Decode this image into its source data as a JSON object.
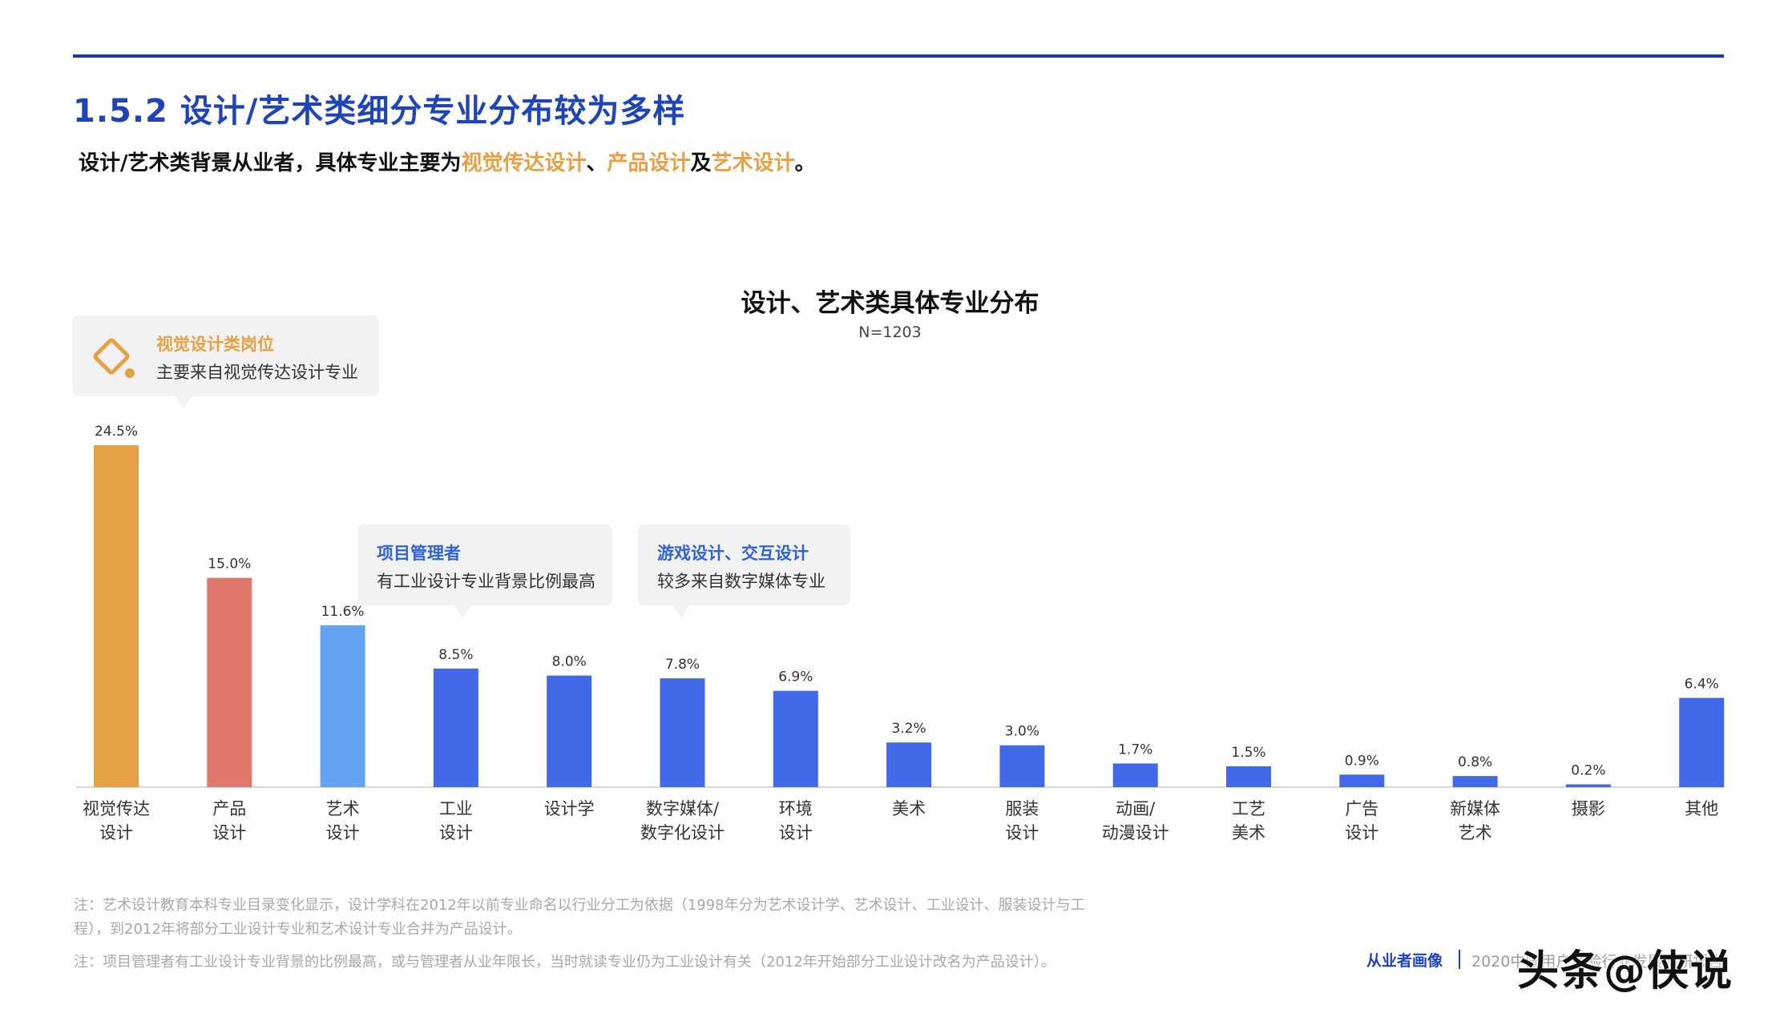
{
  "header": {
    "section_title": "1.5.2 设计/艺术类细分专业分布较为多样",
    "subtitle_prefix": "设计/艺术类背景从业者，具体专业主要为",
    "subtitle_hl1": "视觉传达设计",
    "subtitle_sep1": "、",
    "subtitle_hl2": "产品设计",
    "subtitle_sep2": "及",
    "subtitle_hl3": "艺术设计",
    "subtitle_end": "。"
  },
  "colors": {
    "accent_orange": "#e6a045",
    "accent_red": "#df776b",
    "accent_light_blue": "#64a3ef",
    "accent_blue": "#4169e8",
    "title_blue": "#1e44b8"
  },
  "callouts": [
    {
      "title": "视觉设计类岗位",
      "body": "主要来自视觉传达设计专业",
      "icon": "paint-bucket-icon"
    },
    {
      "title": "项目管理者",
      "body": "有工业设计专业背景比例最高"
    },
    {
      "title": "游戏设计、交互设计",
      "body": "较多来自数字媒体专业"
    }
  ],
  "chart_data": {
    "type": "bar",
    "title": "设计、艺术类具体专业分布",
    "subtitle": "N=1203",
    "categories": [
      [
        "视觉传达",
        "设计"
      ],
      [
        "产品",
        "设计"
      ],
      [
        "艺术",
        "设计"
      ],
      [
        "工业",
        "设计"
      ],
      [
        "设计学"
      ],
      [
        "数字媒体/",
        "数字化设计"
      ],
      [
        "环境",
        "设计"
      ],
      [
        "美术"
      ],
      [
        "服装",
        "设计"
      ],
      [
        "动画/",
        "动漫设计"
      ],
      [
        "工艺",
        "美术"
      ],
      [
        "广告",
        "设计"
      ],
      [
        "新媒体",
        "艺术"
      ],
      [
        "摄影"
      ],
      [
        "其他"
      ]
    ],
    "values": [
      24.5,
      15.0,
      11.6,
      8.5,
      8.0,
      7.8,
      6.9,
      3.2,
      3.0,
      1.7,
      1.5,
      0.9,
      0.8,
      0.2,
      6.4
    ],
    "value_labels": [
      "24.5%",
      "15.0%",
      "11.6%",
      "8.5%",
      "8.0%",
      "7.8%",
      "6.9%",
      "3.2%",
      "3.0%",
      "1.7%",
      "1.5%",
      "0.9%",
      "0.8%",
      "0.2%",
      "6.4%"
    ],
    "bar_colors": [
      "#e6a045",
      "#df776b",
      "#64a3ef",
      "#4169e8",
      "#4169e8",
      "#4169e8",
      "#4169e8",
      "#4169e8",
      "#4169e8",
      "#4169e8",
      "#4169e8",
      "#4169e8",
      "#4169e8",
      "#4169e8",
      "#4169e8"
    ],
    "unit": "%",
    "ylim": [
      0,
      24.5
    ],
    "grid": false,
    "legend": "none"
  },
  "notes": [
    "注：艺术设计教育本科专业目录变化显示，设计学科在2012年以前专业命名以行业分工为依据（1998年分为艺术设计学、艺术设计、工业设计、服装设计与工程），到2012年将部分工业设计专业和艺术设计专业合并为产品设计。",
    "注：项目管理者有工业设计专业背景的比例最高，或与管理者从业年限长，当时就读专业仍为工业设计有关（2012年开始部分工业设计改名为产品设计）。"
  ],
  "footer": {
    "left": "从业者画像",
    "right": "2020中国用户体验行业发展调研报告"
  },
  "watermark": "头条@侠说"
}
